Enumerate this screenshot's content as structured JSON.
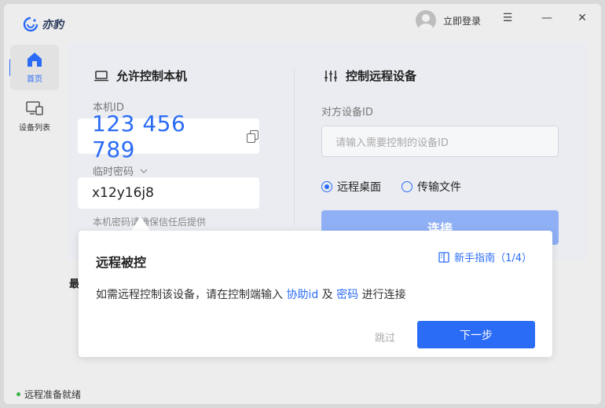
{
  "app": {
    "name": "亦豹"
  },
  "titlebar": {
    "login": "立即登录",
    "menu_glyph": "☰",
    "minimize_glyph": "—",
    "close_glyph": "✕"
  },
  "sidebar": {
    "items": [
      {
        "label": "首页",
        "icon": "home-icon",
        "active": true
      },
      {
        "label": "设备列表",
        "icon": "device-list-icon",
        "active": false
      }
    ]
  },
  "local": {
    "title": "允许控制本机",
    "id_label": "本机ID",
    "id_value": "123 456 789",
    "password_label": "临时密码",
    "password_value": "x12y16j8",
    "note": "本机密码请确保信任后提供"
  },
  "remote": {
    "title": "控制远程设备",
    "id_label": "对方设备ID",
    "id_placeholder": "请输入需要控制的设备ID",
    "mode_desktop": "远程桌面",
    "mode_file": "传输文件",
    "connect": "连接"
  },
  "recent_label": "最",
  "guide": {
    "title": "远程被控",
    "link": "新手指南（1/4）",
    "text_pre": "如需远程控制该设备，请在控制端输入 ",
    "highlight_1": "协助id",
    "text_mid": " 及 ",
    "highlight_2": "密码",
    "text_post": " 进行连接",
    "skip": "跳过",
    "next": "下一步"
  },
  "status": {
    "text": "远程准备就绪",
    "color": "#3ab24a"
  },
  "colors": {
    "accent": "#2b6cf6"
  }
}
